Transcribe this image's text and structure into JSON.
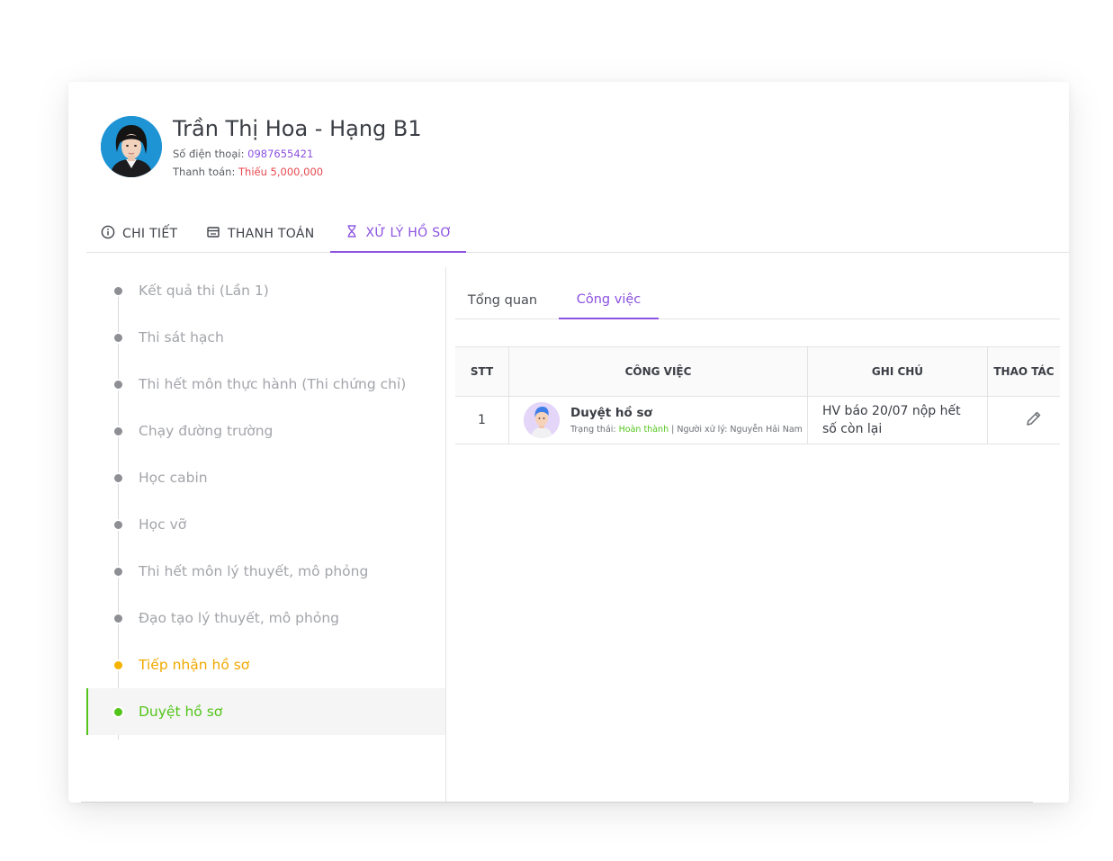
{
  "profile": {
    "name": "Trần Thị Hoa - Hạng B1",
    "phone_label": "Số điện thoại:",
    "phone_value": "0987655421",
    "payment_label": "Thanh toán:",
    "payment_value": "Thiếu 5,000,000"
  },
  "main_tabs": [
    {
      "label": "CHI TIẾT",
      "icon": "info-icon"
    },
    {
      "label": "THANH TOÁN",
      "icon": "receipt-icon"
    },
    {
      "label": "XỬ LÝ HỒ SƠ",
      "icon": "hourglass-icon",
      "active": true
    }
  ],
  "timeline": [
    {
      "label": "Kết quả thi (Lần 1)",
      "state": "inactive"
    },
    {
      "label": "Thi sát hạch",
      "state": "inactive"
    },
    {
      "label": "Thi hết môn thực hành (Thi chứng chỉ)",
      "state": "inactive"
    },
    {
      "label": "Chạy đường trường",
      "state": "inactive"
    },
    {
      "label": "Học cabin",
      "state": "inactive"
    },
    {
      "label": "Học vỡ",
      "state": "inactive"
    },
    {
      "label": "Thi hết môn lý thuyết, mô phỏng",
      "state": "inactive"
    },
    {
      "label": "Đạo tạo lý thuyết, mô phỏng",
      "state": "inactive"
    },
    {
      "label": "Tiếp nhận hồ sơ",
      "state": "pending"
    },
    {
      "label": "Duyệt hồ sơ",
      "state": "active"
    }
  ],
  "sub_tabs": [
    {
      "label": "Tổng quan"
    },
    {
      "label": "Công việc",
      "active": true
    }
  ],
  "table": {
    "headers": [
      "STT",
      "CÔNG VIỆC",
      "GHI CHÚ",
      "THAO TÁC"
    ],
    "rows": [
      {
        "stt": "1",
        "task": "Duyệt hồ sơ",
        "status_label": "Trạng thái:",
        "status_value": "Hoàn thành",
        "handler": "| Người xử lý: Nguyễn Hải Nam",
        "note": "HV báo 20/07 nộp hết số còn lại"
      }
    ]
  },
  "colors": {
    "accent": "#8c52e0",
    "success": "#52c41a",
    "warning": "#f5b300",
    "danger": "#e8484f"
  }
}
